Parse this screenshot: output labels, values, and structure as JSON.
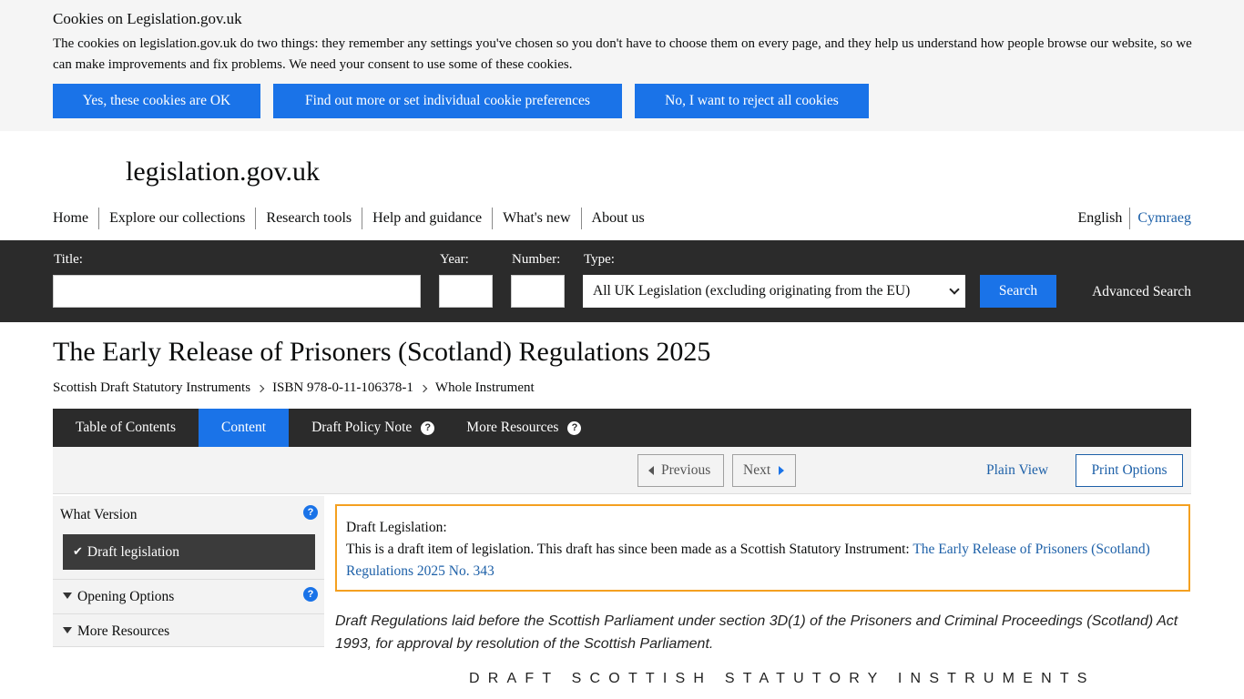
{
  "cookie": {
    "title": "Cookies on Legislation.gov.uk",
    "text": "The cookies on legislation.gov.uk do two things: they remember any settings you've chosen so you don't have to choose them on every page, and they help us understand how people browse our website, so we can make improvements and fix problems. We need your consent to use some of these cookies.",
    "accept_label": "Yes, these cookies are OK",
    "preferences_label": "Find out more or set individual cookie preferences",
    "reject_label": "No, I want to reject all cookies"
  },
  "header": {
    "logo": "legislation.gov.uk",
    "nav": [
      "Home",
      "Explore our collections",
      "Research tools",
      "Help and guidance",
      "What's new",
      "About us"
    ],
    "lang_english": "English",
    "lang_welsh": "Cymraeg"
  },
  "search": {
    "title_label": "Title:",
    "title_value": "",
    "year_label": "Year:",
    "year_value": "",
    "number_label": "Number:",
    "number_value": "",
    "type_label": "Type:",
    "type_selected": "All UK Legislation (excluding originating from the EU)",
    "search_label": "Search",
    "advanced_label": "Advanced Search"
  },
  "document": {
    "title": "The Early Release of Prisoners (Scotland) Regulations 2025",
    "breadcrumb": [
      "Scottish Draft Statutory Instruments",
      "ISBN 978-0-11-106378-1",
      "Whole Instrument"
    ]
  },
  "tabs": [
    {
      "label": "Table of Contents"
    },
    {
      "label": "Content"
    },
    {
      "label": "Draft Policy Note"
    },
    {
      "label": "More Resources"
    }
  ],
  "toolbar": {
    "previous_label": "Previous",
    "next_label": "Next",
    "plain_view_label": "Plain View",
    "print_options_label": "Print Options"
  },
  "sidebar": {
    "what_version_label": "What Version",
    "draft_legislation_label": "Draft legislation",
    "opening_options_label": "Opening Options",
    "more_resources_label": "More Resources"
  },
  "notice": {
    "heading": "Draft Legislation:",
    "text": "This is a draft item of legislation. This draft has since been made as a Scottish Statutory Instrument: ",
    "link_text": "The Early Release of Prisoners (Scotland) Regulations 2025 No. 343"
  },
  "content": {
    "intro": "Draft Regulations laid before the Scottish Parliament under section 3D(1) of the Prisoners and Criminal Proceedings (Scotland) Act 1993, for approval by resolution of the Scottish Parliament.",
    "heading": "DRAFT SCOTTISH STATUTORY INSTRUMENTS"
  },
  "colors": {
    "accent_blue": "#1a73e8",
    "dark_bar": "#2b2b2b",
    "notice_border": "#f4a020",
    "link": "#1d60a8"
  }
}
